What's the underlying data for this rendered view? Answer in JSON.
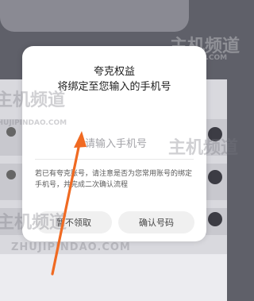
{
  "dialog": {
    "title_line1": "夸克权益",
    "title_line2": "将绑定至您输入的手机号",
    "phone_placeholder": "请输入手机号",
    "notice": "若已有夸克账号，请注意是否为您常用账号的绑定手机号，并完成二次确认流程",
    "later_button": "暂不领取",
    "confirm_button": "确认号码"
  },
  "watermark": {
    "cn": "主机频道",
    "en": "ZHUJIPINDAO.COM"
  },
  "annotation": {
    "arrow_color": "#f06a22"
  }
}
